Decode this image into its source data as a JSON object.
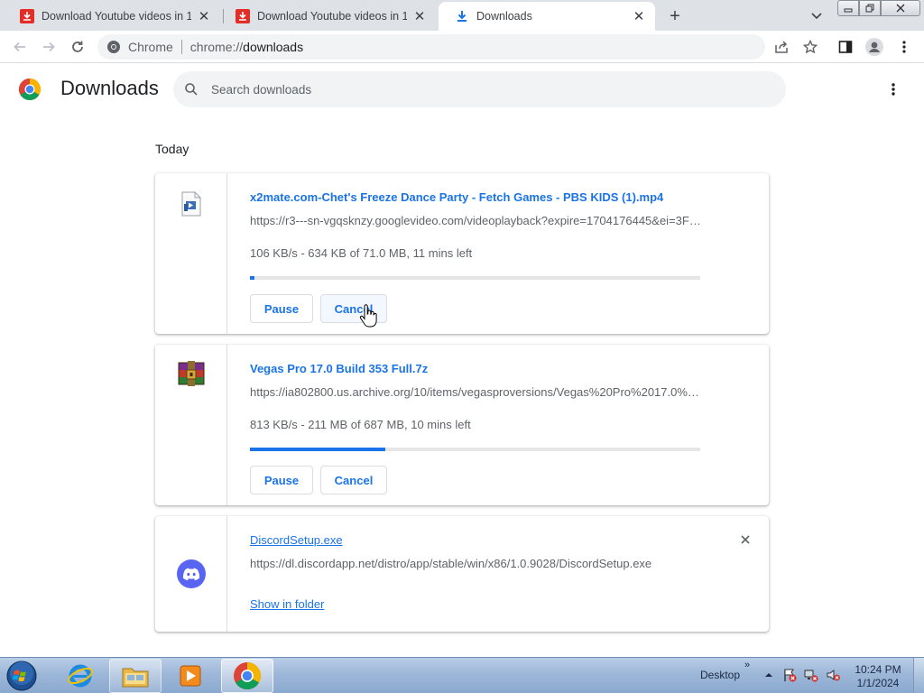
{
  "browser": {
    "tabs": [
      {
        "title": "Download Youtube videos in 1080p",
        "active": false
      },
      {
        "title": "Download Youtube videos in 1080p",
        "active": false
      },
      {
        "title": "Downloads",
        "active": true
      }
    ],
    "omnibox": {
      "chip_label": "Chrome",
      "url_scheme": "chrome://",
      "url_host": "downloads"
    }
  },
  "page": {
    "title": "Downloads",
    "search_placeholder": "Search downloads",
    "section_label": "Today"
  },
  "downloads": [
    {
      "name": "x2mate.com-Chet's Freeze Dance Party - Fetch Games - PBS KIDS (1).mp4",
      "source": "https://r3---sn-vgqsknzy.googlevideo.com/videoplayback?expire=1704176445&ei=3FzpZaKxBqHt...",
      "status": "106 KB/s - 634 KB of 71.0 MB, 11 mins left",
      "progress": 0.01,
      "pause_label": "Pause",
      "cancel_label": "Cancel",
      "icon": "video-file-icon"
    },
    {
      "name": "Vegas Pro 17.0 Build 353 Full.7z",
      "source": "https://ia802800.us.archive.org/10/items/vegasproversions/Vegas%20Pro%2017.0%20Build%20353%20Full.7z",
      "status": "813 KB/s - 211 MB of 687 MB, 10 mins left",
      "progress": 0.3,
      "pause_label": "Pause",
      "cancel_label": "Cancel",
      "icon": "winrar-archive-icon"
    },
    {
      "name": "DiscordSetup.exe",
      "source": "https://dl.discordapp.net/distro/app/stable/win/x86/1.0.9028/DiscordSetup.exe",
      "show_in_folder_label": "Show in folder",
      "icon": "discord-icon"
    }
  ],
  "taskbar": {
    "desktop_label": "Desktop",
    "time": "10:24 PM",
    "date": "1/1/2024"
  },
  "colors": {
    "accent": "#1a73e8",
    "tabstrip": "#dee1e6",
    "secondary_text": "#5f6368"
  }
}
